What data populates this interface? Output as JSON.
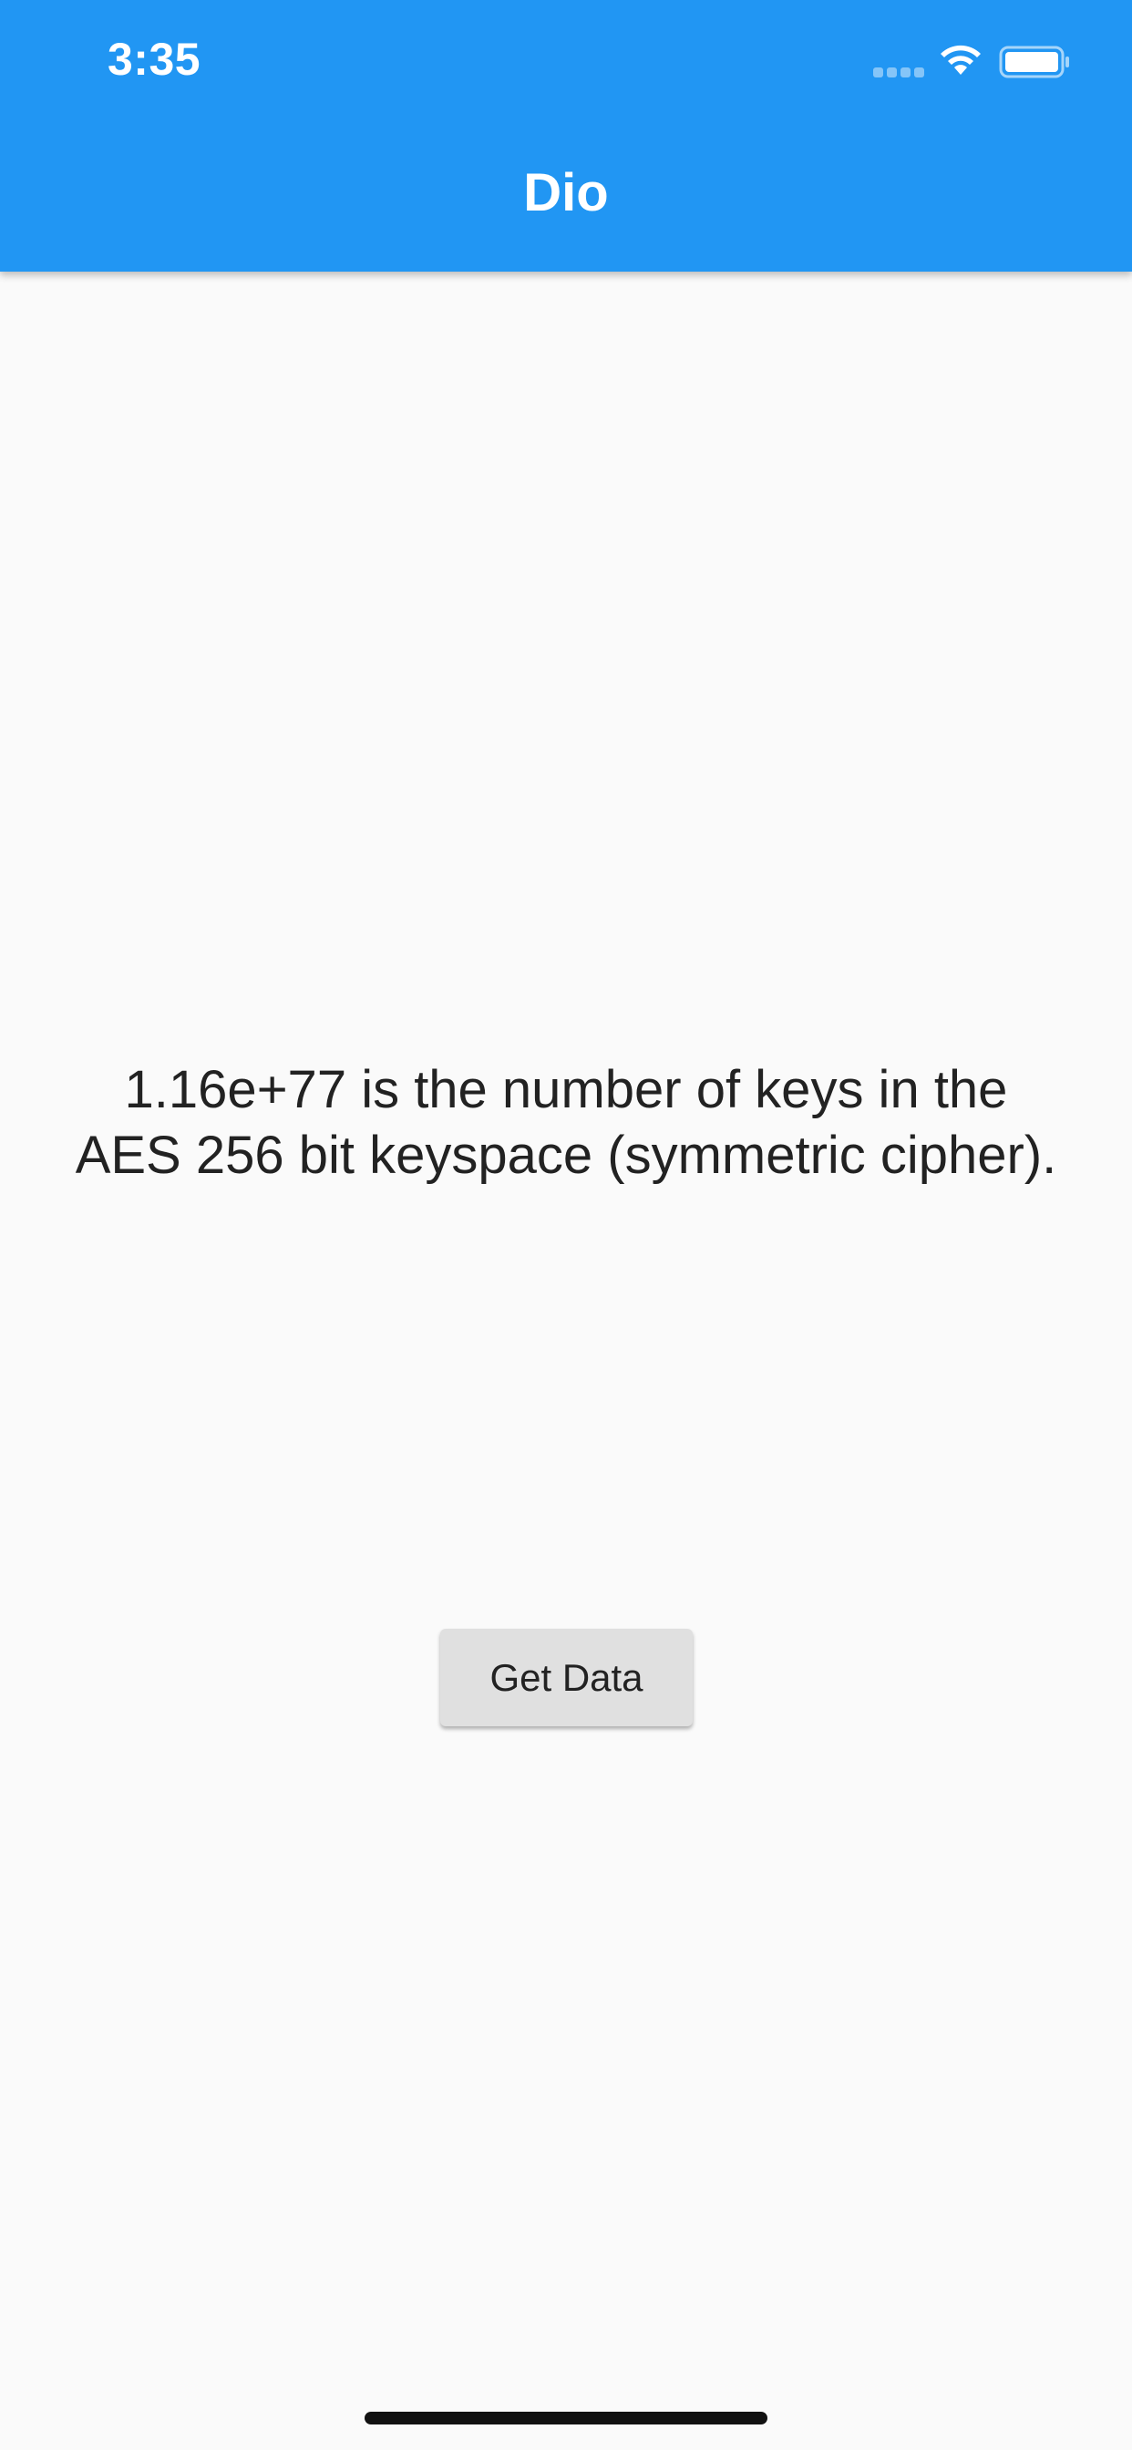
{
  "status_bar": {
    "time": "3:35"
  },
  "app_bar": {
    "title": "Dio",
    "background_color": "#2196f3"
  },
  "main": {
    "message": "1.16e+77 is the number of keys in the AES 256 bit keyspace (symmetric cipher).",
    "button_label": "Get Data"
  },
  "icons": {
    "signal": "cellular-signal-icon",
    "wifi": "wifi-icon",
    "battery": "battery-icon"
  }
}
